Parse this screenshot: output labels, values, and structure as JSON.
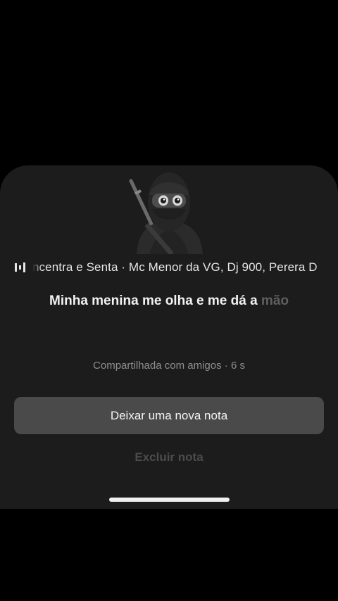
{
  "note": {
    "music_track": "ncentra e Senta · Mc Menor da VG, Dj 900, Perera D",
    "music_icon": "equalizer-bars-icon",
    "lyric_current": "Minha menina me olha e me dá a ",
    "lyric_upcoming": "mão",
    "shared_info": "Compartilhada com amigos · 6 s",
    "avatar_icon": "ninja-avatar"
  },
  "actions": {
    "new_note_label": "Deixar uma nova nota",
    "delete_note_label": "Excluir nota"
  },
  "colors": {
    "background": "#000000",
    "sheet": "#1c1c1c",
    "primary_button": "#4a4a4a",
    "text_primary": "#f2f2f2",
    "text_secondary": "#8e8e8e",
    "text_disabled": "#4c4c4c"
  }
}
